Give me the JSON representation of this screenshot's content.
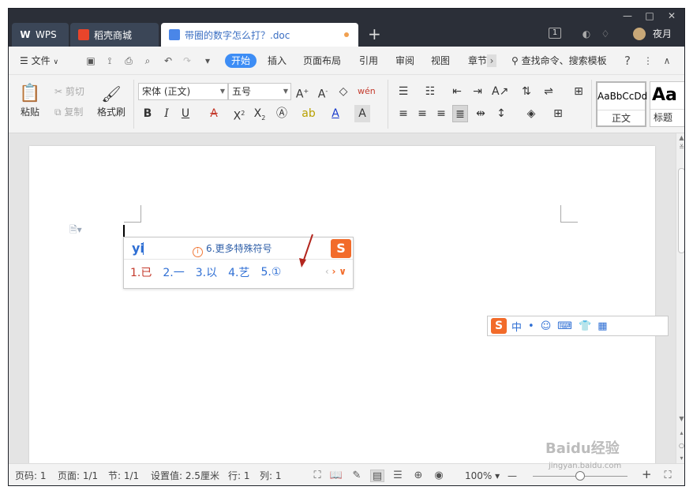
{
  "window": {
    "tabs": [
      {
        "label": "WPS",
        "icon": "wps-logo-icon"
      },
      {
        "label": "稻壳商城",
        "icon": "flame-icon"
      },
      {
        "label": "带圈的数字怎么打？.doc",
        "icon": "word-doc-icon",
        "active": true
      }
    ],
    "new_tab": "+",
    "controls": {
      "minimize": "—",
      "maximize": "□",
      "close": "✕"
    },
    "badge_count": "1",
    "username": "夜月"
  },
  "menu": {
    "file": "文件",
    "items": [
      "开始",
      "插入",
      "页面布局",
      "引用",
      "审阅",
      "视图",
      "章节"
    ],
    "active": "开始",
    "search": "查找命令、搜索模板",
    "help": "?"
  },
  "ribbon": {
    "paste": "粘贴",
    "cut": "剪切",
    "copy": "复制",
    "format_painter": "格式刷",
    "font_name": "宋体 (正文)",
    "font_size": "五号",
    "style_normal_preview": "AaBbCcDd",
    "style_normal_label": "正文",
    "style_heading_preview": "Aa",
    "style_heading_label": "标题"
  },
  "ime": {
    "pinyin": "yi",
    "hint": "6.更多特殊符号",
    "candidates": [
      "1.已",
      "2.一",
      "3.以",
      "4.艺",
      "5.①"
    ],
    "selected_index": 0,
    "logo": "S"
  },
  "sogou_bar": {
    "logo": "S",
    "mode": "中",
    "items": [
      "•",
      "☺",
      "⌨",
      "👕",
      "▦"
    ]
  },
  "watermark": {
    "main": "Baidu经验",
    "sub": "jingyan.baidu.com"
  },
  "status": {
    "page_num": "页码: 1",
    "pages": "页面: 1/1",
    "section": "节: 1/1",
    "setting": "设置值: 2.5厘米",
    "row": "行: 1",
    "col": "列: 1",
    "zoom": "100%",
    "zoom_minus": "—",
    "zoom_plus": "+"
  },
  "colors": {
    "accent": "#3d8df5",
    "titlebar": "#2b2f38",
    "sogou_orange": "#f26b2a",
    "annotation_red": "#b3261e"
  }
}
